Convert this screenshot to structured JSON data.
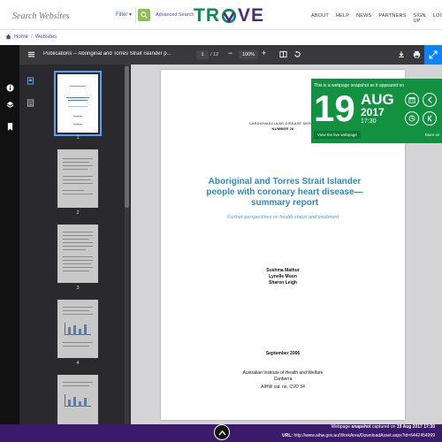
{
  "header": {
    "search_placeholder": "Search Websites",
    "filter_label": "Filter",
    "advanced_search": "Advanced Search",
    "logo": "TROVE",
    "nav": [
      "ABOUT",
      "HELP",
      "NEWS",
      "PARTNERS",
      "SIGN UP",
      "LOGIN"
    ]
  },
  "breadcrumb": {
    "home": "Home",
    "websites": "Websites"
  },
  "toolbar": {
    "title": "Publications -- Aboriginal and Torres Strait Islander p...",
    "page_current": "1",
    "page_total": "/ 12",
    "zoom": "100%"
  },
  "thumbnails": [
    {
      "label": "1",
      "selected": true
    },
    {
      "label": "2",
      "selected": false
    },
    {
      "label": "3",
      "selected": false
    },
    {
      "label": "4",
      "selected": false
    }
  ],
  "document": {
    "series": "CARDIOVASCULAR DISEASE SERIES",
    "number": "NUMBER 26",
    "title_lines": [
      "Aboriginal and Torres Strait Islander",
      "people with coronary heart disease—",
      "summary report"
    ],
    "subtitle": "Further perspectives on health status and treatment",
    "authors": [
      "Sushma Mathur",
      "Lynelle Moon",
      "Sharon Leigh"
    ],
    "date": "September 2006",
    "publisher_lines": [
      "Australian Institute of Health and Welfare",
      "Canberra",
      "AIHW cat. no. CVD 34"
    ]
  },
  "snapshot": {
    "caption": "This is a webpage snapshot as it appeared on",
    "day": "19",
    "month": "AUG",
    "year": "2017",
    "time": "17:30",
    "live_link": "View the live webpage",
    "more": "More sn"
  },
  "footer": {
    "line1_prefix": "Webpage",
    "line1_bold": "snapshot",
    "line1_mid": "captured on",
    "line1_date": "19 Aug 2017 17:30",
    "url_label": "URL:",
    "url": "http://www.aihw.gov.au/WorkArea/DownloadAsset.aspx?id=6442454999"
  },
  "colors": {
    "trove_green": "#0a8a5a",
    "trove_purple": "#4c2a7e",
    "snapshot_green": "#129240",
    "toolbar": "#38383d",
    "title_blue": "#2a8bc9"
  }
}
